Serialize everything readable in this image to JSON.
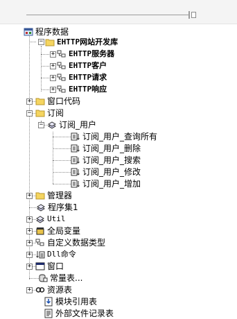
{
  "tree": {
    "root": "程序数据",
    "site_lib": "EHTTP网站开发库",
    "server": "EHTTP服务器",
    "client": "EHTTP客户",
    "request": "EHTTP请求",
    "response": "EHTTP响应",
    "window_code": "窗口代码",
    "subscribe": "订阅",
    "subscribe_user": "订阅_用户",
    "sub_query_all": "订阅_用户_查询所有",
    "sub_delete": "订阅_用户_删除",
    "sub_search": "订阅_用户_搜索",
    "sub_modify": "订阅_用户_修改",
    "sub_add": "订阅_用户_增加",
    "manager": "管理器",
    "program_set": "程序集1",
    "util": "Util",
    "globals": "全局变量",
    "custom_types": "自定义数据类型",
    "dll_cmds": "Dll命令",
    "window": "窗口",
    "constants": "常量表...",
    "resources": "资源表",
    "module_refs": "模块引用表",
    "external_files": "外部文件记录表"
  },
  "expander": {
    "plus": "+",
    "minus": "−"
  },
  "icons": {
    "root": "program-data-icon",
    "folder": "folder-icon",
    "class": "class-module-icon",
    "assembly": "assembly-icon",
    "method": "subroutine-icon",
    "global": "global-variable-icon",
    "dll": "dll-command-icon",
    "window": "window-icon",
    "constant": "constant-table-icon",
    "resource": "resource-table-icon",
    "module_ref": "module-reference-icon",
    "external": "external-file-icon"
  },
  "colors": {
    "folder": "#f5d560",
    "folder_edge": "#b8962e",
    "accent_red": "#e23a3a"
  }
}
